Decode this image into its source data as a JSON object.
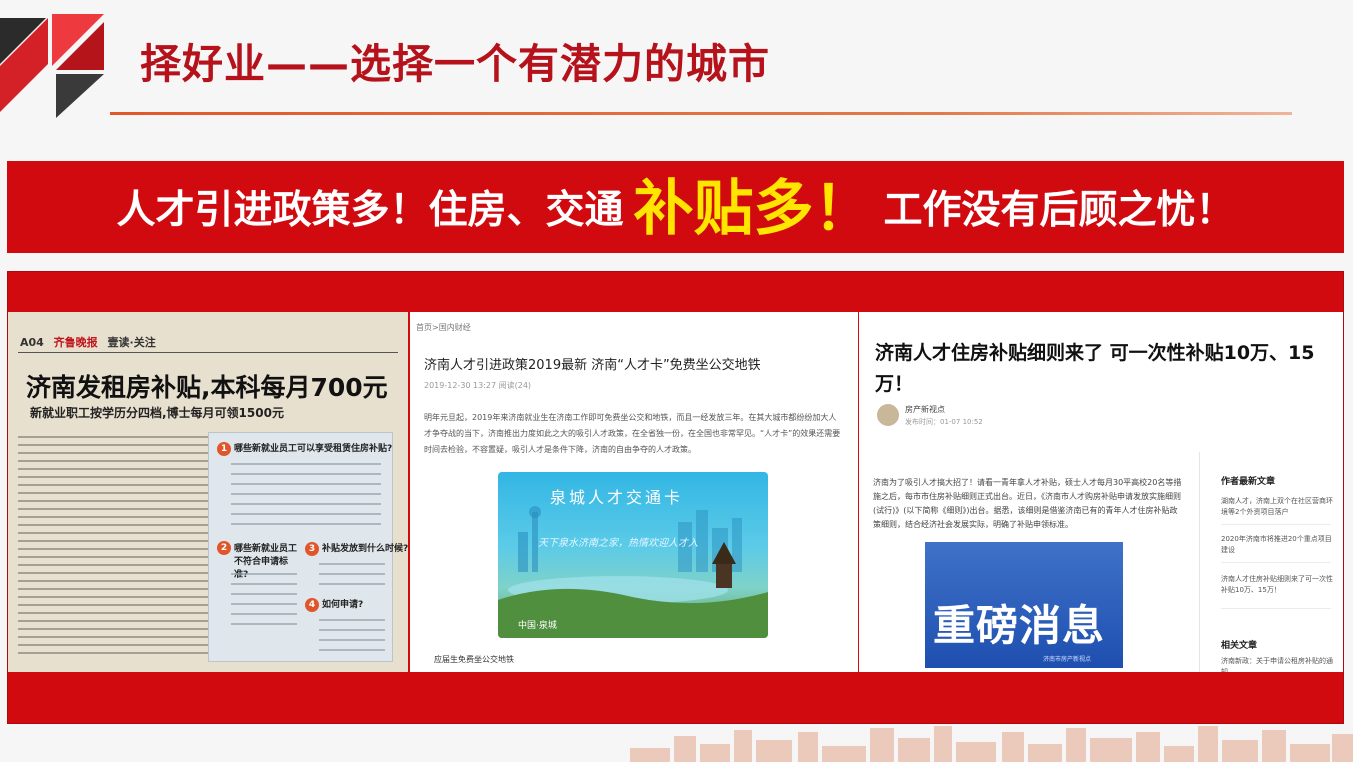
{
  "title": "择好业——选择一个有潜力的城市",
  "banner": {
    "part1": "人才引进政策多！住房、交通",
    "highlight": "补贴多！",
    "part2": "工作没有后顾之忧！"
  },
  "colors": {
    "brand_red": "#d10a10",
    "title_red": "#b5121b",
    "highlight_yellow": "#ffe500",
    "rule_orange": "#e2572a"
  },
  "newspaper": {
    "page_no": "A04",
    "masthead": "齐鲁晚报",
    "section": "壹读·关注",
    "headline": "济南发租房补贴,本科每月700元",
    "subhead": "新就业职工按学历分四档,博士每月可领1500元",
    "questions": [
      {
        "num": "1",
        "text": "哪些新就业员工可以享受租赁住房补贴?"
      },
      {
        "num": "2",
        "text": "哪些新就业员工不符合申请标准?"
      },
      {
        "num": "3",
        "text": "补贴发放到什么时候?"
      },
      {
        "num": "4",
        "text": "如何申请?"
      }
    ]
  },
  "article1": {
    "breadcrumb": "首页>国内财经",
    "headline": "济南人才引进政策2019最新 济南“人才卡”免费坐公交地铁",
    "meta": "2019-12-30 13:27    阅读(24)",
    "body": "明年元旦起，2019年来济南就业生在济南工作即可免费坐公交和地铁，而且一经发放三年。在其大城市都纷纷加大人才争夺战的当下，济南推出力度如此之大的吸引人才政策，在全省独一份，在全国也非常罕见。“人才卡”的效果还需要时间去检验，不容置疑，吸引人才是条件下降，济南的自由争夺的人才政策。",
    "card_title": "泉城人才交通卡",
    "card_slogan": "天下泉水济南之家，热情欢迎人才入",
    "card_footer": "中国·泉城",
    "caption": "应届生免费坐公交地铁"
  },
  "article2": {
    "headline": "济南人才住房补贴细则来了    可一次性补贴10万、15万！",
    "author": "房产新视点",
    "time": "发布时间：01-07 10:52",
    "body": "济南为了吸引人才搞大招了！请看一青年拿人才补贴，硕士人才每月30平高校20名等措施之后，每市市住房补贴细则正式出台。近日，《济南市人才购房补贴申请发放实施细则(试行)》(以下简称《细则》)出台。据悉，该细则是借鉴济南已有的青年人才住房补贴政策细则，结合经济社会发展实际，明确了补贴申领标准。",
    "news_banner": "重磅消息",
    "news_footer": "济南市房产新视点",
    "sidebar_heading": "作者最新文章",
    "sidebar_items": [
      "湖南人才，济南上双个在社区营商环境等2个外资项目落户",
      "2020年济南市将推进20个重点项目建设",
      "济南人才住房补贴细则来了可一次性补贴10万、15万！"
    ],
    "related_heading": "相关文章",
    "related_items": [
      "济南新政：关于申请公租房补贴的通知"
    ]
  }
}
